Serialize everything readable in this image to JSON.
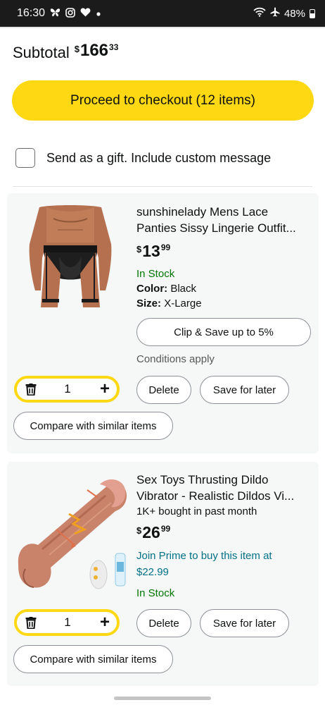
{
  "status": {
    "time": "16:30",
    "battery": "48%",
    "icons": [
      "butterfly-icon",
      "instagram-icon",
      "heart-icon",
      "dot-icon",
      "wifi-icon",
      "airplane-icon",
      "battery-icon"
    ]
  },
  "cart": {
    "subtotal_label": "Subtotal",
    "subtotal_currency": "$",
    "subtotal_whole": "166",
    "subtotal_fraction": "33",
    "checkout_label": "Proceed to checkout (12 items)",
    "gift_label": "Send as a gift. Include custom message"
  },
  "items": [
    {
      "title_line1": "sunshinelady Mens Lace",
      "title_line2": "Panties Sissy Lingerie Outfit...",
      "currency": "$",
      "price_whole": "13",
      "price_fraction": "99",
      "stock": "In Stock",
      "color_label": "Color:",
      "color_value": "Black",
      "size_label": "Size:",
      "size_value": "X-Large",
      "clip_label": "Clip & Save up to 5%",
      "conditions": "Conditions apply",
      "quantity": "1",
      "delete_label": "Delete",
      "save_label": "Save for later",
      "compare_label": "Compare with similar items"
    },
    {
      "title_line1": "Sex Toys Thrusting Dildo",
      "title_line2": "Vibrator - Realistic Dildos Vi...",
      "bought": "1K+ bought in past month",
      "currency": "$",
      "price_whole": "26",
      "price_fraction": "99",
      "prime_line1": "Join Prime to buy this item at",
      "prime_line2": "$22.99",
      "stock": "In Stock",
      "quantity": "1",
      "delete_label": "Delete",
      "save_label": "Save for later",
      "compare_label": "Compare with similar items"
    }
  ],
  "colors": {
    "accent": "#ffd814",
    "stock": "#007600",
    "prime": "#007185"
  }
}
